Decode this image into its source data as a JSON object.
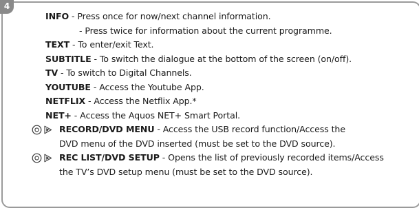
{
  "page": {
    "number": "4"
  },
  "entries": [
    {
      "term": "INFO",
      "sep": " - ",
      "text": "Press once for now/next channel information."
    },
    {
      "term": "",
      "sep": "",
      "text": "- Press twice for information about the current programme."
    },
    {
      "term": "TEXT",
      "sep": " - ",
      "text": "To enter/exit Text."
    },
    {
      "term": "SUBTITLE",
      "sep": " - ",
      "text": "To switch the dialogue at the bottom of the screen (on/off)."
    },
    {
      "term": "TV",
      "sep": " - ",
      "text": "To switch to Digital Channels."
    },
    {
      "term": "YOUTUBE",
      "sep": " - ",
      "text": "Access the Youtube App."
    },
    {
      "term": "NETFLIX",
      "sep": " - ",
      "text": "Access the Netflix App.*"
    },
    {
      "term": "NET+",
      "sep": " - ",
      "text": "Access the Aquos NET+ Smart Portal."
    },
    {
      "term": "RECORD/DVD MENU",
      "sep": " - ",
      "text": "Access the USB record function/Access the"
    },
    {
      "term": "",
      "sep": "",
      "text": "DVD menu of the DVD inserted (must be set to the DVD source)."
    },
    {
      "term": "REC LIST/DVD SETUP",
      "sep": " - ",
      "text": "Opens the list of previously recorded items/Access"
    },
    {
      "term": "",
      "sep": "",
      "text": "the TV’s DVD setup menu (must be set to the DVD source)."
    }
  ],
  "icons": {
    "record_dvd_menu": [
      "record-button-icon",
      "play-button-icon"
    ],
    "rec_list_dvd_setup": [
      "record-button-icon",
      "play-button-icon"
    ]
  }
}
